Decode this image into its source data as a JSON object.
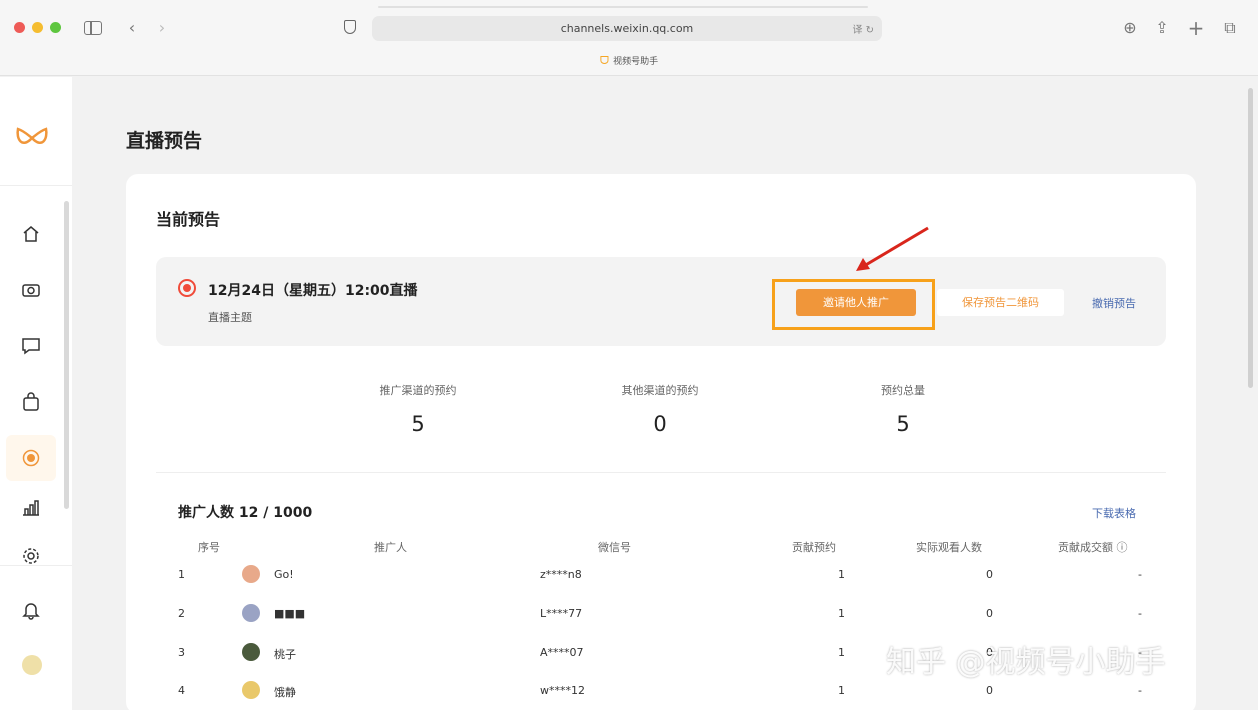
{
  "browser": {
    "url": "channels.weixin.qq.com",
    "tab_title": "视频号助手",
    "translate_label": "译"
  },
  "sidebar": {
    "items": [
      {
        "name": "home",
        "icon": "home-icon"
      },
      {
        "name": "camera",
        "icon": "camera-icon"
      },
      {
        "name": "comment",
        "icon": "comment-icon"
      },
      {
        "name": "shop",
        "icon": "shopping-bag-icon"
      },
      {
        "name": "live",
        "icon": "live-icon",
        "active": true
      },
      {
        "name": "data",
        "icon": "chart-icon"
      },
      {
        "name": "settings",
        "icon": "gear-icon"
      },
      {
        "name": "notifications",
        "icon": "bell-icon"
      }
    ]
  },
  "page": {
    "title": "直播预告",
    "card_title": "当前预告"
  },
  "preview": {
    "time": "12月24日（星期五）12:00直播",
    "subtitle": "直播主题",
    "invite_button": "邀请他人推广",
    "save_button": "保存预告二维码",
    "cancel_link": "撤销预告"
  },
  "stats": [
    {
      "label": "推广渠道的预约",
      "value": "5"
    },
    {
      "label": "其他渠道的预约",
      "value": "0"
    },
    {
      "label": "预约总量",
      "value": "5"
    }
  ],
  "promoters": {
    "title": "推广人数 12 / 1000",
    "download_link": "下载表格",
    "columns": [
      "序号",
      "推广人",
      "微信号",
      "贡献预约",
      "实际观看人数",
      "贡献成交额"
    ],
    "rows": [
      {
        "index": "1",
        "name": "Go!",
        "wechat": "z****n8",
        "reservations": "1",
        "viewers": "0",
        "gmv": "-"
      },
      {
        "index": "2",
        "name": "■■■",
        "wechat": "L****77",
        "reservations": "1",
        "viewers": "0",
        "gmv": "-"
      },
      {
        "index": "3",
        "name": "桃子",
        "wechat": "A****07",
        "reservations": "1",
        "viewers": "0",
        "gmv": "-"
      },
      {
        "index": "4",
        "name": "饿静",
        "wechat": "w****12",
        "reservations": "1",
        "viewers": "0",
        "gmv": "-"
      }
    ]
  },
  "watermark": "知乎 @视频号小助手",
  "colors": {
    "accent": "#f0963a",
    "highlight": "#f7a11a",
    "live_red": "#f04b3a",
    "link_blue": "#4a6bb0"
  }
}
